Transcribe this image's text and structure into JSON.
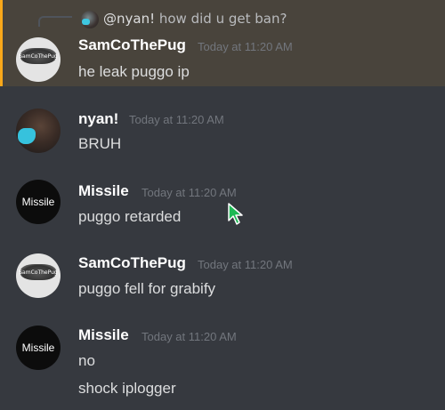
{
  "reply": {
    "author": "@nyan!",
    "text": " how did u get ban?"
  },
  "messages": [
    {
      "author": "SamCoTheP ug",
      "author_display": "SamCoThePug",
      "time": "Today at 11:20 AM",
      "lines": [
        "he leak puggo ip"
      ],
      "avatar": "pug-avatar",
      "avatar_text": "SamCoThePug"
    },
    {
      "author_display": "nyan!",
      "time": "Today at 11:20 AM",
      "lines": [
        "BRUH"
      ],
      "avatar": "nyan-avatar"
    },
    {
      "author_display": "Missile",
      "time": "Today at 11:20 AM",
      "lines": [
        "puggo retarded"
      ],
      "avatar": "missile-avatar",
      "avatar_text": "Missile"
    },
    {
      "author_display": "SamCoThePug",
      "time": "Today at 11:20 AM",
      "lines": [
        "puggo fell for grabify"
      ],
      "avatar": "pug-avatar",
      "avatar_text": "SamCoThePug"
    },
    {
      "author_display": "Missile",
      "time": "Today at 11:20 AM",
      "lines": [
        "no",
        "shock iplogger"
      ],
      "avatar": "missile-avatar",
      "avatar_text": "Missile"
    }
  ],
  "colors": {
    "background": "#36393f",
    "highlight_background": "#49443c",
    "highlight_border": "#faa81a",
    "username": "#ffffff",
    "timestamp": "#72767d",
    "message_text": "#dcddde",
    "cursor": "#1db954"
  },
  "cursor_icon": "mouse-pointer-icon"
}
